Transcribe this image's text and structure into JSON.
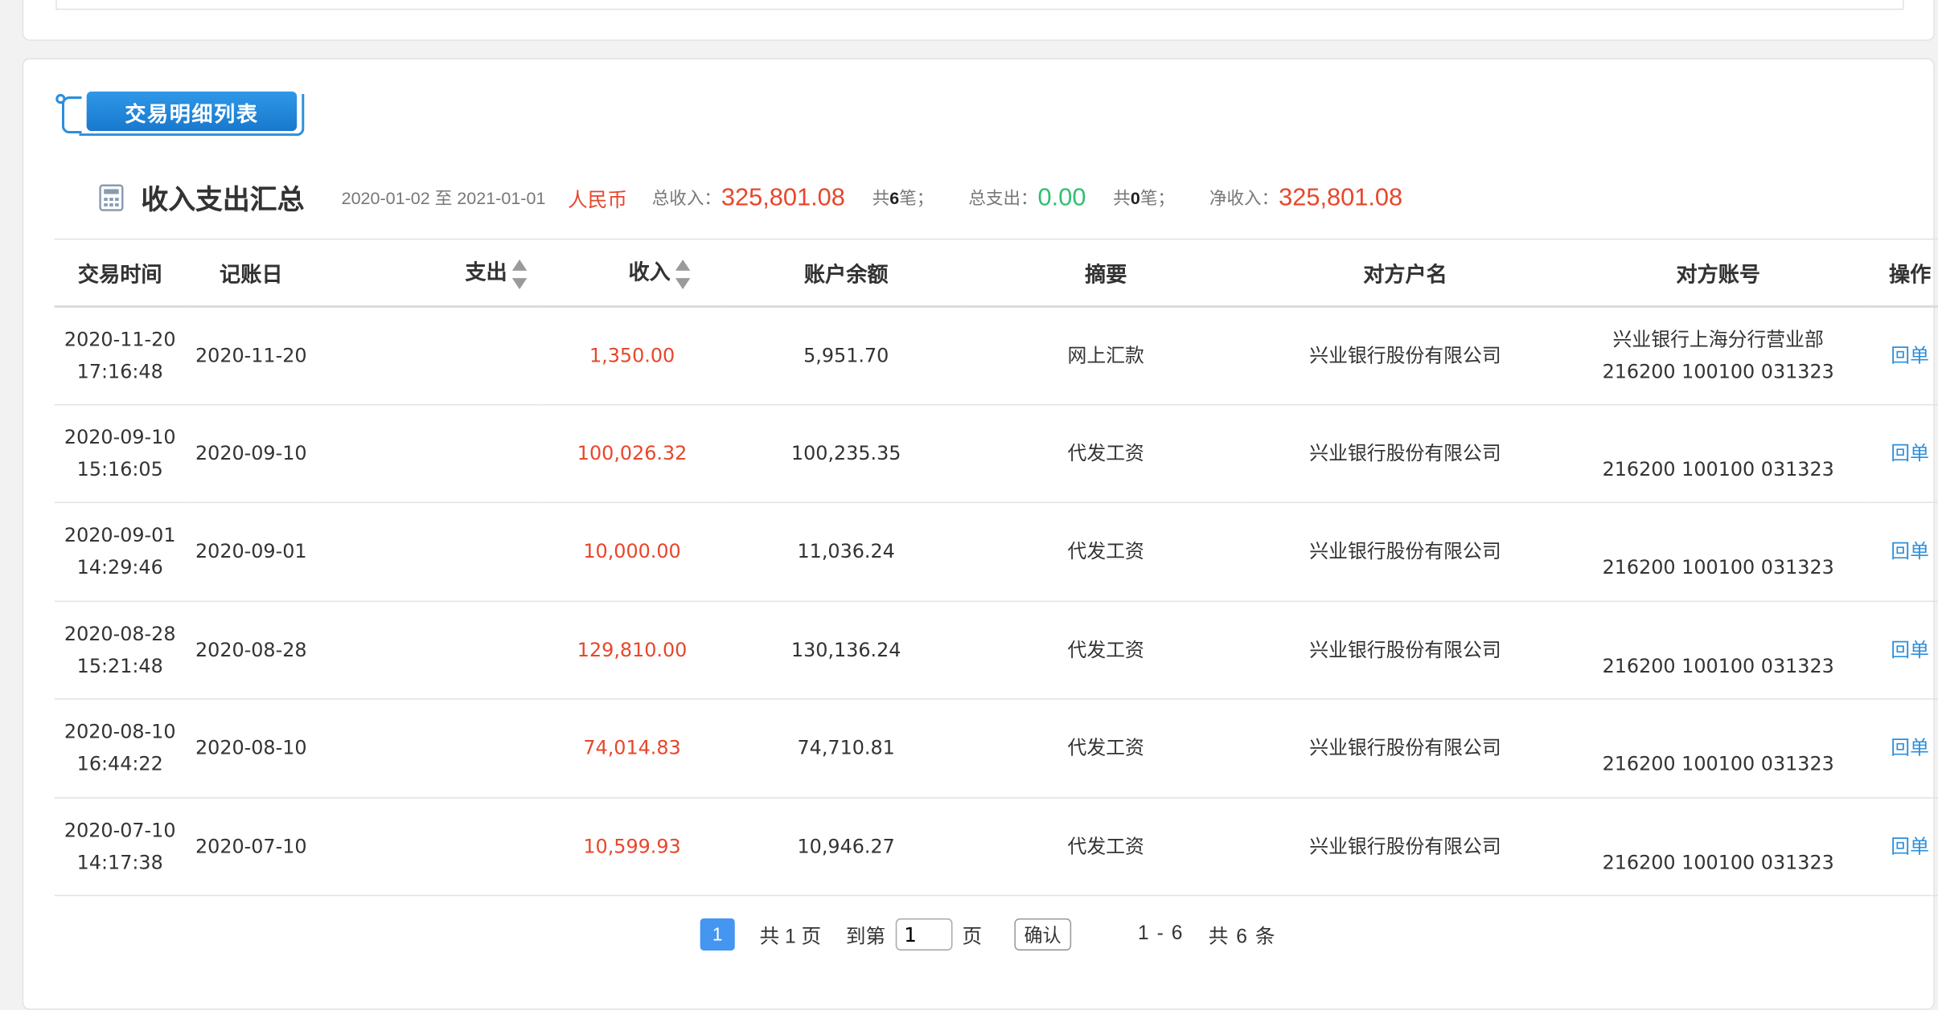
{
  "section_tab": {
    "label": "交易明细列表"
  },
  "summary": {
    "title": "收入支出汇总",
    "date_range": "2020-01-02 至 2021-01-01",
    "currency": "人民币",
    "total_income_label": "总收入：",
    "total_income_value": "325,801.08",
    "income_count_prefix": "共",
    "income_count": "6",
    "income_count_suffix": "笔；",
    "total_expense_label": "总支出：",
    "total_expense_value": "0.00",
    "expense_count_prefix": "共",
    "expense_count": "0",
    "expense_count_suffix": "笔；",
    "net_income_label": "净收入：",
    "net_income_value": "325,801.08"
  },
  "table": {
    "headers": [
      "交易时间",
      "记账日",
      "支出",
      "收入",
      "账户余额",
      "摘要",
      "对方户名",
      "对方账号",
      "操作"
    ],
    "rows": [
      {
        "time_date": "2020-11-20",
        "time_clock": "17:16:48",
        "post_date": "2020-11-20",
        "expense": "",
        "income": "1,350.00",
        "balance": "5,951.70",
        "memo": "网上汇款",
        "counterparty": "兴业银行股份有限公司",
        "account_name": "兴业银行上海分行营业部",
        "account_no": "216200 100100 031323",
        "action": "回单"
      },
      {
        "time_date": "2020-09-10",
        "time_clock": "15:16:05",
        "post_date": "2020-09-10",
        "expense": "",
        "income": "100,026.32",
        "balance": "100,235.35",
        "memo": "代发工资",
        "counterparty": "兴业银行股份有限公司",
        "account_name": "",
        "account_no": "216200 100100 031323",
        "action": "回单"
      },
      {
        "time_date": "2020-09-01",
        "time_clock": "14:29:46",
        "post_date": "2020-09-01",
        "expense": "",
        "income": "10,000.00",
        "balance": "11,036.24",
        "memo": "代发工资",
        "counterparty": "兴业银行股份有限公司",
        "account_name": "",
        "account_no": "216200 100100 031323",
        "action": "回单"
      },
      {
        "time_date": "2020-08-28",
        "time_clock": "15:21:48",
        "post_date": "2020-08-28",
        "expense": "",
        "income": "129,810.00",
        "balance": "130,136.24",
        "memo": "代发工资",
        "counterparty": "兴业银行股份有限公司",
        "account_name": "",
        "account_no": "216200 100100 031323",
        "action": "回单"
      },
      {
        "time_date": "2020-08-10",
        "time_clock": "16:44:22",
        "post_date": "2020-08-10",
        "expense": "",
        "income": "74,014.83",
        "balance": "74,710.81",
        "memo": "代发工资",
        "counterparty": "兴业银行股份有限公司",
        "account_name": "",
        "account_no": "216200 100100 031323",
        "action": "回单"
      },
      {
        "time_date": "2020-07-10",
        "time_clock": "14:17:38",
        "post_date": "2020-07-10",
        "expense": "",
        "income": "10,599.93",
        "balance": "10,946.27",
        "memo": "代发工资",
        "counterparty": "兴业银行股份有限公司",
        "account_name": "",
        "account_no": "216200 100100 031323",
        "action": "回单"
      }
    ]
  },
  "pager": {
    "current_page": "1",
    "total_pages_text": "共 1 页",
    "goto_prefix": "到第",
    "goto_value": "1",
    "goto_suffix": "页",
    "confirm_label": "确认",
    "range_text": "1 - 6",
    "total_items_text": "共 6 条"
  },
  "colors": {
    "accent": "#2c8fdc",
    "income": "#e8462b",
    "expense": "#2fbf71",
    "page_active": "#4496f0"
  },
  "icons": {
    "summary_icon": "calculator-icon",
    "sort_icon": "sort-arrows-icon"
  }
}
